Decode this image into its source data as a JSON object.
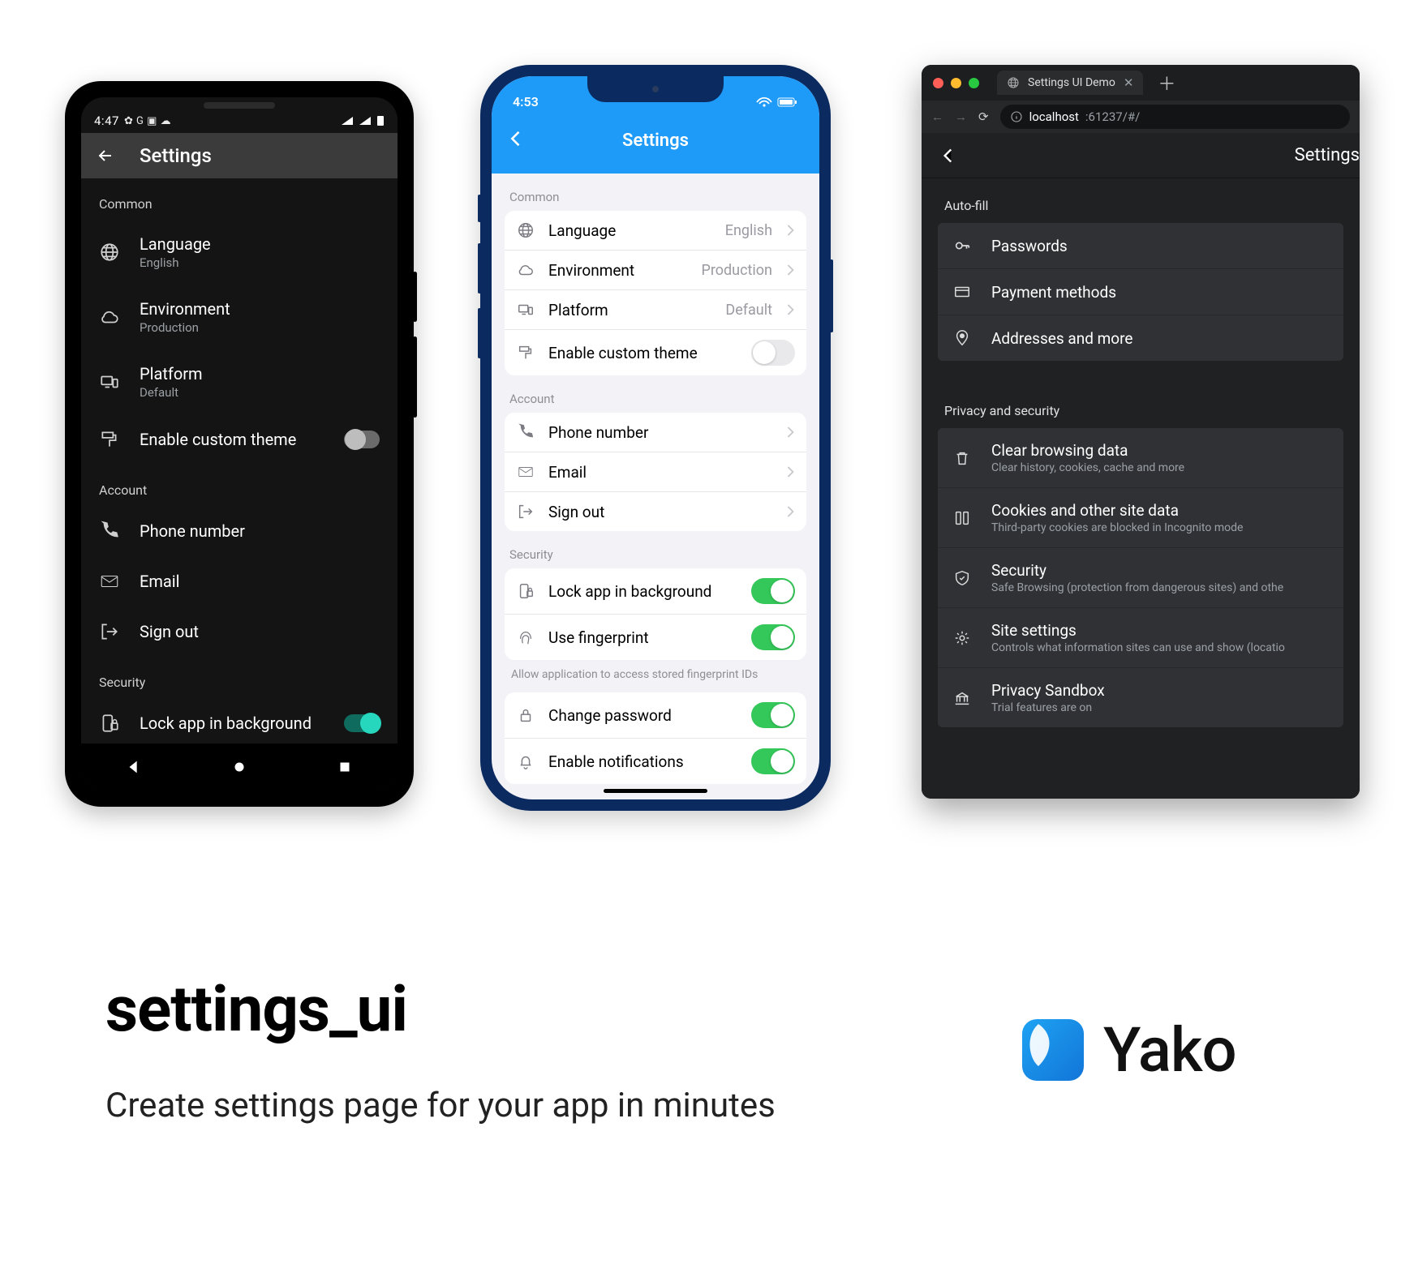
{
  "android": {
    "status": {
      "time": "4:47",
      "icons": "⚙ G ■ ☁"
    },
    "title": "Settings",
    "sections": {
      "common": {
        "label": "Common",
        "language": {
          "label": "Language",
          "value": "English"
        },
        "environment": {
          "label": "Environment",
          "value": "Production"
        },
        "platform": {
          "label": "Platform",
          "value": "Default"
        },
        "theme": {
          "label": "Enable custom theme",
          "on": false
        }
      },
      "account": {
        "label": "Account",
        "phone": {
          "label": "Phone number"
        },
        "email": {
          "label": "Email"
        },
        "signout": {
          "label": "Sign out"
        }
      },
      "security": {
        "label": "Security",
        "lock": {
          "label": "Lock app in background",
          "on": true
        }
      }
    }
  },
  "ios": {
    "status": {
      "time": "4:53"
    },
    "title": "Settings",
    "sections": {
      "common": {
        "label": "Common",
        "language": {
          "label": "Language",
          "value": "English"
        },
        "environment": {
          "label": "Environment",
          "value": "Production"
        },
        "platform": {
          "label": "Platform",
          "value": "Default"
        },
        "theme": {
          "label": "Enable custom theme",
          "on": false
        }
      },
      "account": {
        "label": "Account",
        "phone": {
          "label": "Phone number"
        },
        "email": {
          "label": "Email"
        },
        "signout": {
          "label": "Sign out"
        }
      },
      "security": {
        "label": "Security",
        "lock": {
          "label": "Lock app in background",
          "on": true
        },
        "fingerprint": {
          "label": "Use fingerprint",
          "on": true
        },
        "hint": "Allow application to access stored fingerprint IDs",
        "password": {
          "label": "Change password",
          "on": true
        },
        "notifications": {
          "label": "Enable notifications",
          "on": true
        }
      }
    }
  },
  "web": {
    "tab_title": "Settings UI Demo",
    "url_host": "localhost",
    "url_path": ":61237/#/",
    "title": "Settings",
    "sections": {
      "autofill": {
        "label": "Auto-fill",
        "passwords": {
          "label": "Passwords"
        },
        "payment": {
          "label": "Payment methods"
        },
        "addresses": {
          "label": "Addresses and more"
        }
      },
      "privacy": {
        "label": "Privacy and security",
        "clear": {
          "label": "Clear browsing data",
          "sub": "Clear history, cookies, cache and more"
        },
        "cookies": {
          "label": "Cookies and other site data",
          "sub": "Third-party cookies are blocked in Incognito mode"
        },
        "security": {
          "label": "Security",
          "sub": "Safe Browsing (protection from dangerous sites) and othe"
        },
        "site": {
          "label": "Site settings",
          "sub": "Controls what information sites can use and show (locatio"
        },
        "sandbox": {
          "label": "Privacy Sandbox",
          "sub": "Trial features are on"
        }
      }
    }
  },
  "marketing": {
    "title": "settings_ui",
    "subtitle": "Create settings page for your app in minutes",
    "brand": "Yako"
  }
}
